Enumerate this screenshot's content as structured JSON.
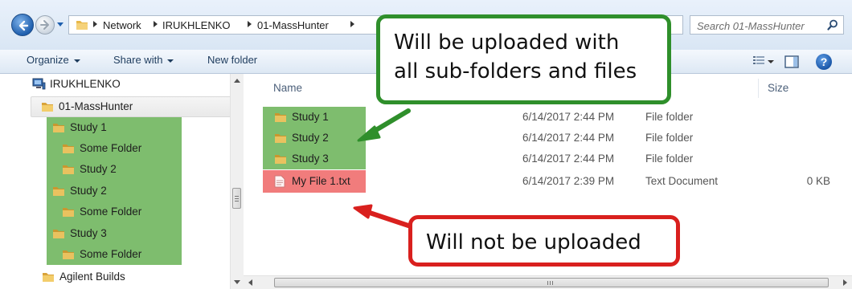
{
  "address_bar": {
    "breadcrumbs": [
      "Network",
      "IRUKHLENKO",
      "01-MassHunter"
    ],
    "search_placeholder": "Search 01-MassHunter"
  },
  "toolbar": {
    "organize": "Organize",
    "share_with": "Share with",
    "new_folder": "New folder"
  },
  "nav_pane": {
    "items": [
      {
        "label": "IRUKHLENKO",
        "icon": "computer-icon"
      },
      {
        "label": "01-MassHunter",
        "icon": "folder-icon",
        "selected": true
      },
      {
        "label": "Study 1",
        "icon": "folder-icon",
        "highlight": "green"
      },
      {
        "label": "Some Folder",
        "icon": "folder-icon",
        "highlight": "green"
      },
      {
        "label": "Study 2",
        "icon": "folder-icon",
        "highlight": "green"
      },
      {
        "label": "Study 2",
        "icon": "folder-icon",
        "highlight": "green"
      },
      {
        "label": "Some Folder",
        "icon": "folder-icon",
        "highlight": "green"
      },
      {
        "label": "Study 3",
        "icon": "folder-icon",
        "highlight": "green"
      },
      {
        "label": "Some Folder",
        "icon": "folder-icon",
        "highlight": "green"
      },
      {
        "label": "Agilent Builds",
        "icon": "folder-icon"
      }
    ]
  },
  "file_list": {
    "columns": {
      "name": "Name",
      "size": "Size"
    },
    "rows": [
      {
        "name": "Study 1",
        "date": "6/14/2017 2:44 PM",
        "type": "File folder",
        "size": "",
        "icon": "folder-icon",
        "highlight": "green"
      },
      {
        "name": "Study 2",
        "date": "6/14/2017 2:44 PM",
        "type": "File folder",
        "size": "",
        "icon": "folder-icon",
        "highlight": "green"
      },
      {
        "name": "Study 3",
        "date": "6/14/2017 2:44 PM",
        "type": "File folder",
        "size": "",
        "icon": "folder-icon",
        "highlight": "green"
      },
      {
        "name": "My File 1.txt",
        "date": "6/14/2017 2:39 PM",
        "type": "Text Document",
        "size": "0 KB",
        "icon": "text-file-icon",
        "highlight": "red"
      }
    ]
  },
  "callouts": {
    "uploaded_line1": "Will be uploaded with",
    "uploaded_line2": "all sub-folders and files",
    "not_uploaded": "Will not be uploaded"
  },
  "colors": {
    "highlight_green": "#7ebd6e",
    "highlight_red": "#f17c7c",
    "callout_green_border": "#2f8f2b",
    "callout_red_border": "#d9201e"
  }
}
